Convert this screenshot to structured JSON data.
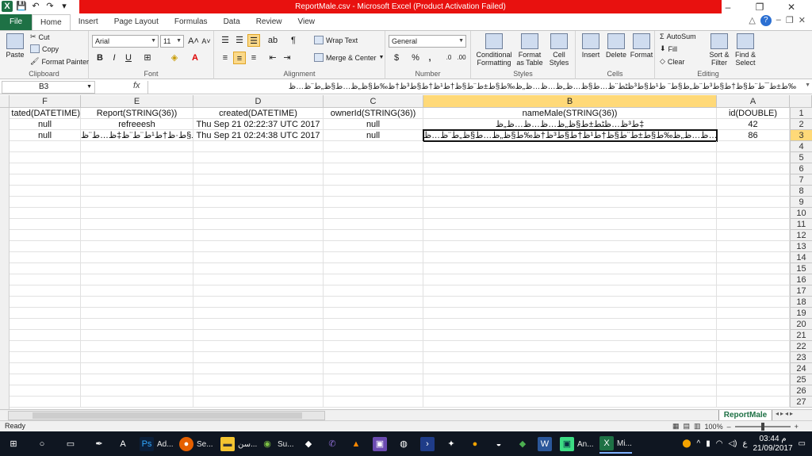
{
  "window": {
    "title": "ReportMale.csv  -  Microsoft Excel (Product Activation Failed)",
    "controls": [
      "–",
      "❐",
      "✕"
    ]
  },
  "ribbon_tabs": [
    "File",
    "Home",
    "Insert",
    "Page Layout",
    "Formulas",
    "Data",
    "Review",
    "View"
  ],
  "clipboard": {
    "paste": "Paste",
    "cut": "Cut",
    "copy": "Copy",
    "format_painter": "Format Painter",
    "label": "Clipboard"
  },
  "font": {
    "name": "Arial",
    "size": "11",
    "bold": "B",
    "italic": "I",
    "underline": "U",
    "label": "Font"
  },
  "alignment": {
    "wrap_text": "Wrap Text",
    "merge_center": "Merge & Center",
    "label": "Alignment"
  },
  "number": {
    "format": "General",
    "percent": "%",
    "comma": ",",
    "label": "Number"
  },
  "styles": {
    "conditional": "Conditional Formatting",
    "format_table": "Format as Table",
    "cell_styles": "Cell Styles",
    "label": "Styles"
  },
  "cells": {
    "insert": "Insert",
    "delete": "Delete",
    "format": "Format",
    "label": "Cells"
  },
  "editing": {
    "autosum": "AutoSum",
    "fill": "Fill",
    "clear": "Clear",
    "sort_filter": "Sort & Filter",
    "find_select": "Find & Select",
    "label": "Editing"
  },
  "formula_bar": {
    "name_box": "B3",
    "fx": "fx",
    "value": "ط±ط¯ط¨ط§ظ†ط§ط³ط¨ظ„ط§ط¨ ط¹ط§ط³ظٹط¨ظ…ط§ظ…ظ„ظ…ظ…ظ„ظ‰ط§ط±ط¨ط§ظ†ط¹ظ†ط§ط³ظ†ظ‰ط§ظ„ظ…ط§ظ„ط¨ظ…ظ‰"
  },
  "columns": [
    {
      "letter": "F",
      "header": "tated(DATETIME)"
    },
    {
      "letter": "E",
      "header": "Report(STRING(36))"
    },
    {
      "letter": "D",
      "header": "created(DATETIME)"
    },
    {
      "letter": "C",
      "header": "ownerId(STRING(36))"
    },
    {
      "letter": "B",
      "header": "nameMale(STRING(36))"
    },
    {
      "letter": "A",
      "header": "id(DOUBLE)"
    }
  ],
  "rows": [
    [
      "null",
      "refreeesh",
      "Thu Sep 21 02:22:37 UTC 2017",
      "null",
      "ط³ظ…ظٹط±ط§ظ„ظ…ظ…ظ…ظ„ظ‡",
      "42"
    ],
    [
      "null",
      "ظ…ط§ط·ظ†ط¹ط¨ط¨ظ‡ظ…ط¨ظ…",
      "Thu Sep 21 02:24:38 UTC 2017",
      "null",
      "ط±ط¯ط¨ط§ظ†ط§ط³ط¨ظ„ط§ط¨ ط¹ط§ط³ظٹط¨ظ…ط§ظ…ظ„ظ…ظ…ظ„ظ‰ط§ط±ط¨ط§ظ†ط¹ظ†ط§ط³ظ†ظ‰ط§ظ„ظ…ط§ظ„ط¨ظ…ظ‰",
      "86"
    ]
  ],
  "row_numbers": [
    "1",
    "2",
    "3",
    "4",
    "5",
    "6",
    "7",
    "8",
    "9",
    "10",
    "11",
    "12",
    "13",
    "14",
    "15",
    "16",
    "17",
    "18",
    "19",
    "20",
    "21",
    "22",
    "23",
    "24",
    "25",
    "26",
    "27"
  ],
  "sheet_tab": "ReportMale",
  "status": {
    "ready": "Ready",
    "zoom": "100%"
  },
  "taskbar": {
    "items": [
      "Ad...",
      "Se...",
      "سن...",
      "Su...",
      "An...",
      "Mi..."
    ],
    "time": "03:44 م",
    "date": "21/09/2017",
    "lang": "ع"
  }
}
